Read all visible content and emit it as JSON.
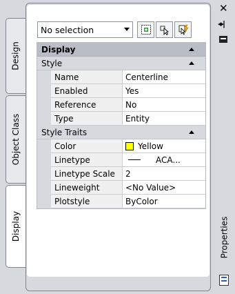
{
  "tabs": [
    {
      "label": "Design"
    },
    {
      "label": "Object Class"
    },
    {
      "label": "Display"
    }
  ],
  "selection": {
    "value": "No selection"
  },
  "toolbar": {
    "toggle_icon": "toggle-pickadd-icon",
    "select_icon": "select-objects-icon",
    "quick_select_icon": "quick-select-icon"
  },
  "grid": {
    "category": "Display",
    "style_group": {
      "label": "Style",
      "rows": [
        {
          "name": "Name",
          "value": "Centerline"
        },
        {
          "name": "Enabled",
          "value": "Yes"
        },
        {
          "name": "Reference",
          "value": "No"
        },
        {
          "name": "Type",
          "value": "Entity"
        }
      ]
    },
    "traits_group": {
      "label": "Style Traits",
      "rows": [
        {
          "name": "Color",
          "value": "Yellow",
          "swatch": "#ffff00"
        },
        {
          "name": "Linetype",
          "value": "ACA..."
        },
        {
          "name": "Linetype Scale",
          "value": "2"
        },
        {
          "name": "Lineweight",
          "value": "<No Value>"
        },
        {
          "name": "Plotstyle",
          "value": "ByColor"
        }
      ]
    }
  },
  "palette": {
    "title": "Properties",
    "close_icon": "close-icon",
    "autohide_icon": "autohide-icon",
    "menu_icon": "menu-icon"
  },
  "colors": {
    "panel": "#d6d9dd",
    "category": "#b9bec6",
    "swatch_yellow": "#ffff00"
  }
}
